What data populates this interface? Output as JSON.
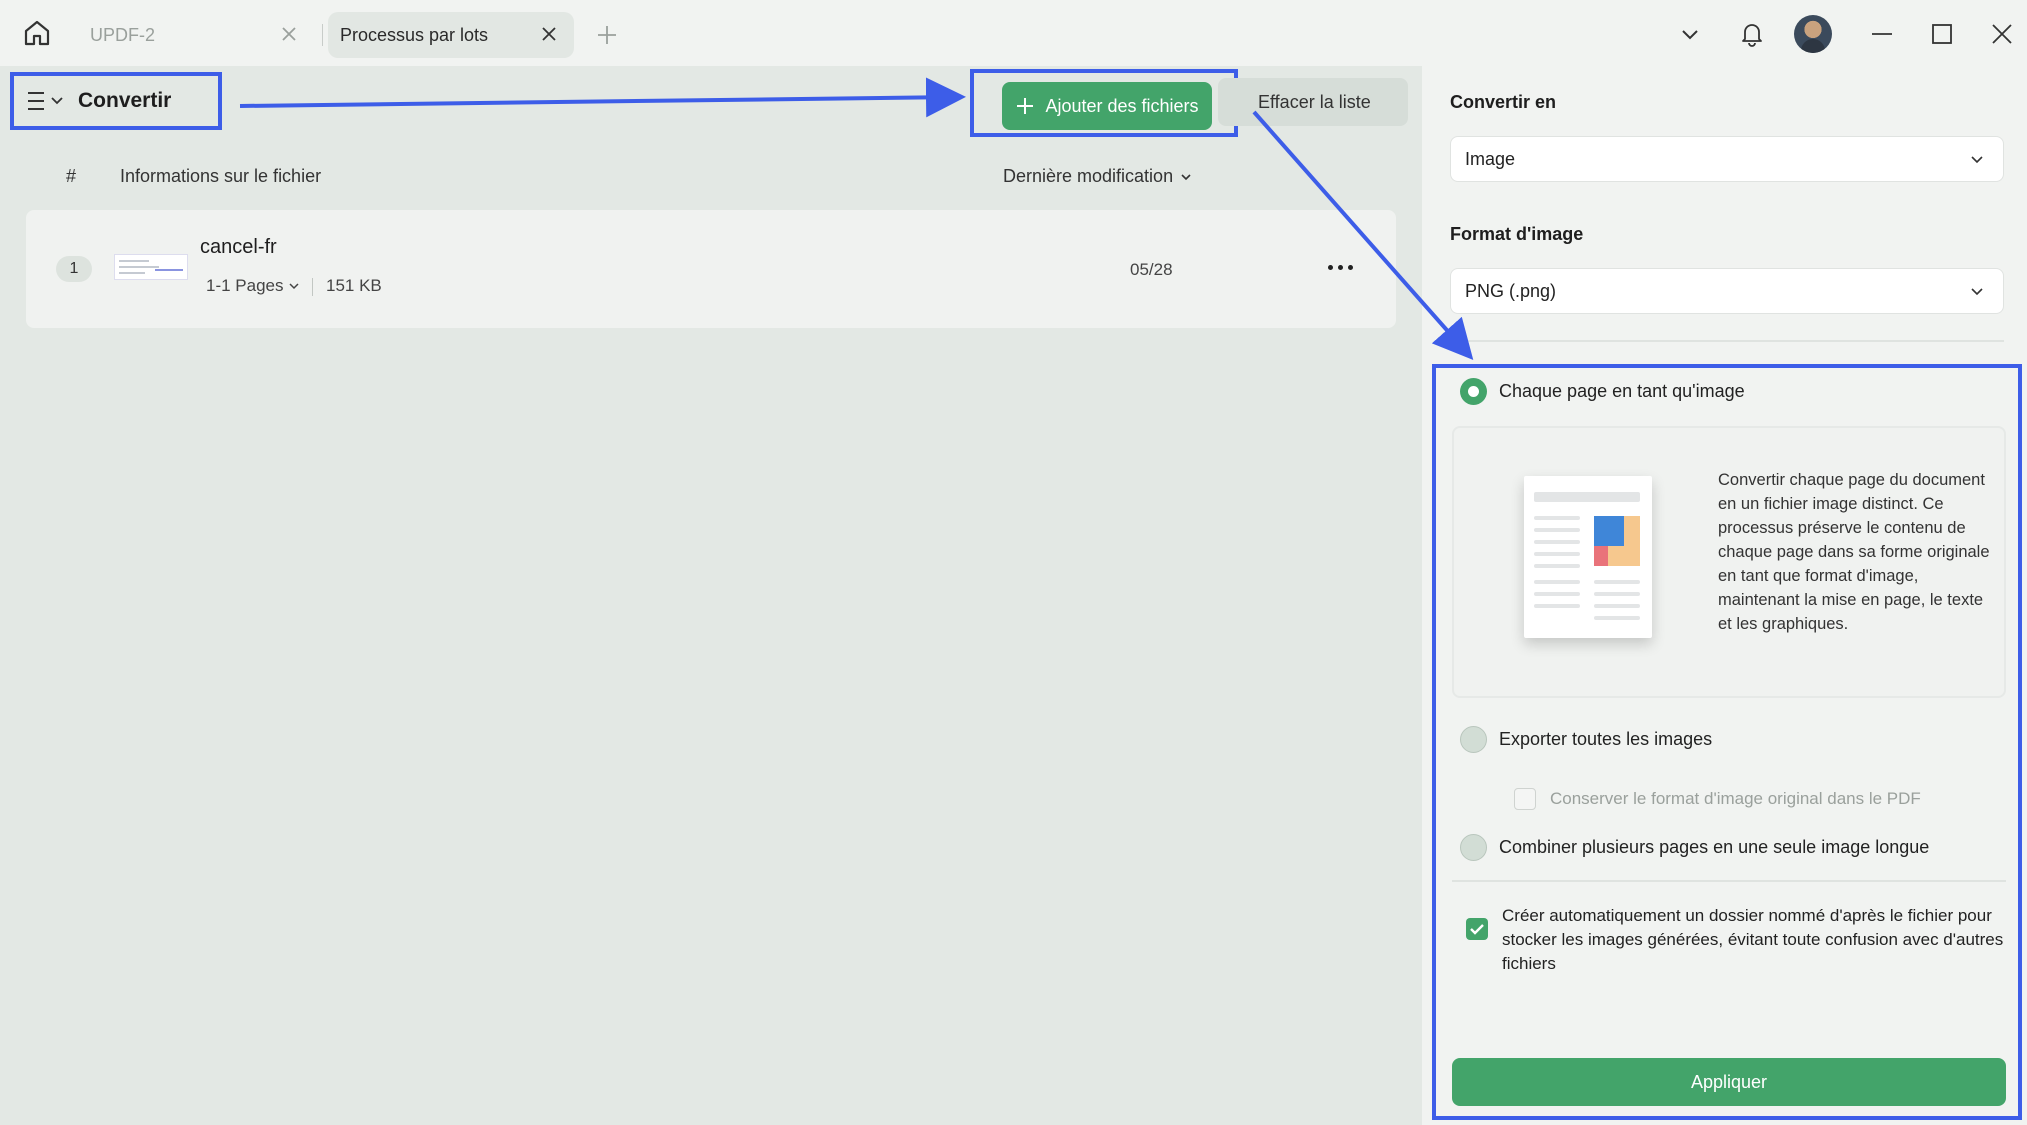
{
  "tabs": [
    {
      "label": "UPDF-2",
      "active": false
    },
    {
      "label": "Processus par lots",
      "active": true
    }
  ],
  "toolbar": {
    "title": "Convertir",
    "add_files_label": "Ajouter des fichiers",
    "clear_list_label": "Effacer la liste"
  },
  "list": {
    "columns": {
      "num": "#",
      "info": "Informations sur le fichier",
      "modified": "Dernière modification"
    },
    "files": [
      {
        "index": "1",
        "name": "cancel-fr",
        "pages": "1-1 Pages",
        "size": "151 KB",
        "date": "05/28"
      }
    ]
  },
  "panel": {
    "convert_to_label": "Convertir en",
    "convert_to_value": "Image",
    "image_format_label": "Format d'image",
    "image_format_value": "PNG (.png)",
    "options": [
      {
        "label": "Chaque page en tant qu'image",
        "selected": true
      },
      {
        "label": "Exporter toutes les images",
        "selected": false
      },
      {
        "label": "Combiner plusieurs pages en une seule image longue",
        "selected": false
      }
    ],
    "description": "Convertir chaque page du document en un fichier image distinct. Ce processus préserve le contenu de chaque page dans sa forme originale en tant que format d'image, maintenant la mise en page, le texte et les graphiques.",
    "keep_format_label": "Conserver le format d'image original dans le PDF",
    "keep_format_checked": false,
    "auto_folder_label": "Créer automatiquement un dossier nommé d'après le fichier pour stocker les images générées, évitant toute confusion avec d'autres fichiers",
    "auto_folder_checked": true,
    "apply_label": "Appliquer"
  },
  "colors": {
    "accent": "#43a46a",
    "annotation": "#3d5de8",
    "background": "#e3e8e4",
    "panel": "#f1f3f1"
  },
  "icons": [
    "home-icon",
    "close-icon",
    "plus-icon",
    "chevron-down-icon",
    "bell-icon",
    "minimize-icon",
    "maximize-icon",
    "hamburger-icon",
    "more-icon",
    "check-icon"
  ]
}
